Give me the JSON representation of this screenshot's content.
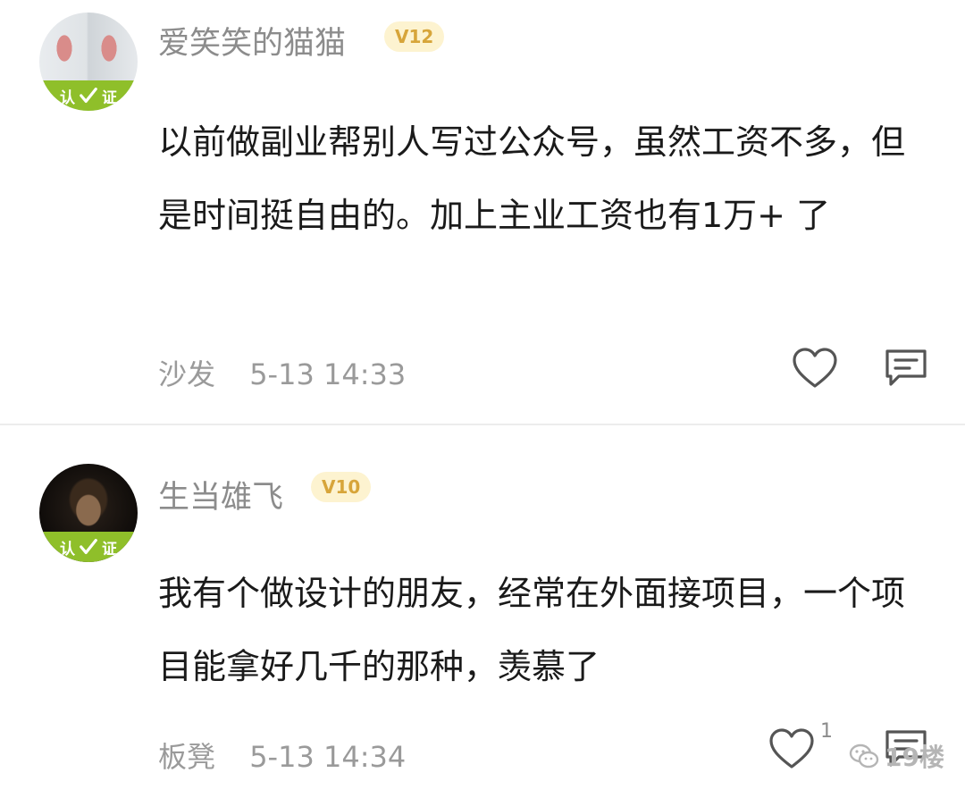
{
  "comments": [
    {
      "username": "爱笑笑的猫猫",
      "level": "V12",
      "verify_label_left": "认",
      "verify_label_right": "证",
      "text": "以前做副业帮别人写过公众号，虽然工资不多，但是时间挺自由的。加上主业工资也有1万+ 了",
      "floor": "沙发",
      "time": "5-13 14:33",
      "likes": ""
    },
    {
      "username": "生当雄飞",
      "level": "V10",
      "verify_label_left": "认",
      "verify_label_right": "证",
      "text": "我有个做设计的朋友，经常在外面接项目，一个项目能拿好几千的那种，羡慕了",
      "floor": "板凳",
      "time": "5-13 14:34",
      "likes": "1"
    }
  ],
  "watermark": {
    "text": "19楼"
  },
  "icons": {
    "like": "heart-outline-icon",
    "reply": "comment-bubble-icon",
    "verify": "check-mark-icon",
    "watermark": "wechat-icon"
  },
  "colors": {
    "verify_band": "#8fbf2a",
    "badge_bg": "#fdf3d0",
    "badge_text": "#d7a53a",
    "muted_text": "#8c8c8c"
  }
}
